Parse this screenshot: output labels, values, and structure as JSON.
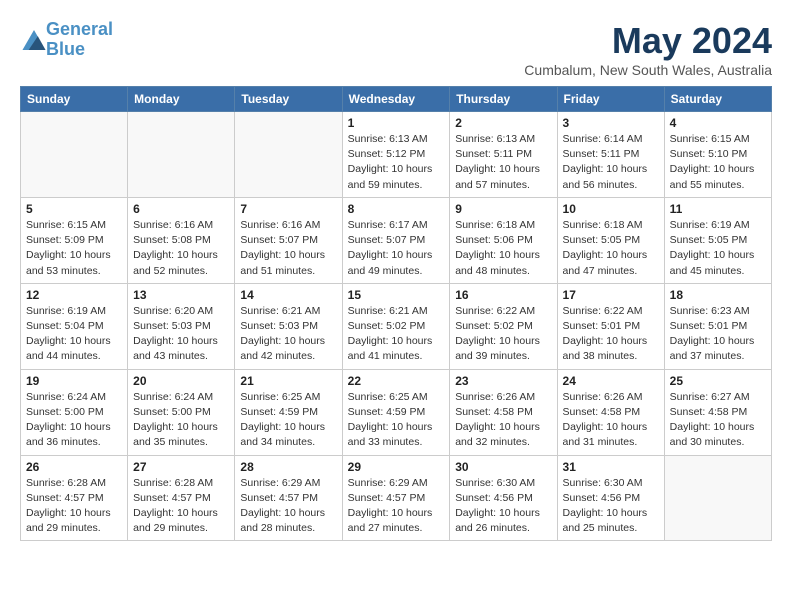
{
  "header": {
    "logo_line1": "General",
    "logo_line2": "Blue",
    "month": "May 2024",
    "location": "Cumbalum, New South Wales, Australia"
  },
  "days_of_week": [
    "Sunday",
    "Monday",
    "Tuesday",
    "Wednesday",
    "Thursday",
    "Friday",
    "Saturday"
  ],
  "weeks": [
    [
      {
        "day": "",
        "info": ""
      },
      {
        "day": "",
        "info": ""
      },
      {
        "day": "",
        "info": ""
      },
      {
        "day": "1",
        "info": "Sunrise: 6:13 AM\nSunset: 5:12 PM\nDaylight: 10 hours\nand 59 minutes."
      },
      {
        "day": "2",
        "info": "Sunrise: 6:13 AM\nSunset: 5:11 PM\nDaylight: 10 hours\nand 57 minutes."
      },
      {
        "day": "3",
        "info": "Sunrise: 6:14 AM\nSunset: 5:11 PM\nDaylight: 10 hours\nand 56 minutes."
      },
      {
        "day": "4",
        "info": "Sunrise: 6:15 AM\nSunset: 5:10 PM\nDaylight: 10 hours\nand 55 minutes."
      }
    ],
    [
      {
        "day": "5",
        "info": "Sunrise: 6:15 AM\nSunset: 5:09 PM\nDaylight: 10 hours\nand 53 minutes."
      },
      {
        "day": "6",
        "info": "Sunrise: 6:16 AM\nSunset: 5:08 PM\nDaylight: 10 hours\nand 52 minutes."
      },
      {
        "day": "7",
        "info": "Sunrise: 6:16 AM\nSunset: 5:07 PM\nDaylight: 10 hours\nand 51 minutes."
      },
      {
        "day": "8",
        "info": "Sunrise: 6:17 AM\nSunset: 5:07 PM\nDaylight: 10 hours\nand 49 minutes."
      },
      {
        "day": "9",
        "info": "Sunrise: 6:18 AM\nSunset: 5:06 PM\nDaylight: 10 hours\nand 48 minutes."
      },
      {
        "day": "10",
        "info": "Sunrise: 6:18 AM\nSunset: 5:05 PM\nDaylight: 10 hours\nand 47 minutes."
      },
      {
        "day": "11",
        "info": "Sunrise: 6:19 AM\nSunset: 5:05 PM\nDaylight: 10 hours\nand 45 minutes."
      }
    ],
    [
      {
        "day": "12",
        "info": "Sunrise: 6:19 AM\nSunset: 5:04 PM\nDaylight: 10 hours\nand 44 minutes."
      },
      {
        "day": "13",
        "info": "Sunrise: 6:20 AM\nSunset: 5:03 PM\nDaylight: 10 hours\nand 43 minutes."
      },
      {
        "day": "14",
        "info": "Sunrise: 6:21 AM\nSunset: 5:03 PM\nDaylight: 10 hours\nand 42 minutes."
      },
      {
        "day": "15",
        "info": "Sunrise: 6:21 AM\nSunset: 5:02 PM\nDaylight: 10 hours\nand 41 minutes."
      },
      {
        "day": "16",
        "info": "Sunrise: 6:22 AM\nSunset: 5:02 PM\nDaylight: 10 hours\nand 39 minutes."
      },
      {
        "day": "17",
        "info": "Sunrise: 6:22 AM\nSunset: 5:01 PM\nDaylight: 10 hours\nand 38 minutes."
      },
      {
        "day": "18",
        "info": "Sunrise: 6:23 AM\nSunset: 5:01 PM\nDaylight: 10 hours\nand 37 minutes."
      }
    ],
    [
      {
        "day": "19",
        "info": "Sunrise: 6:24 AM\nSunset: 5:00 PM\nDaylight: 10 hours\nand 36 minutes."
      },
      {
        "day": "20",
        "info": "Sunrise: 6:24 AM\nSunset: 5:00 PM\nDaylight: 10 hours\nand 35 minutes."
      },
      {
        "day": "21",
        "info": "Sunrise: 6:25 AM\nSunset: 4:59 PM\nDaylight: 10 hours\nand 34 minutes."
      },
      {
        "day": "22",
        "info": "Sunrise: 6:25 AM\nSunset: 4:59 PM\nDaylight: 10 hours\nand 33 minutes."
      },
      {
        "day": "23",
        "info": "Sunrise: 6:26 AM\nSunset: 4:58 PM\nDaylight: 10 hours\nand 32 minutes."
      },
      {
        "day": "24",
        "info": "Sunrise: 6:26 AM\nSunset: 4:58 PM\nDaylight: 10 hours\nand 31 minutes."
      },
      {
        "day": "25",
        "info": "Sunrise: 6:27 AM\nSunset: 4:58 PM\nDaylight: 10 hours\nand 30 minutes."
      }
    ],
    [
      {
        "day": "26",
        "info": "Sunrise: 6:28 AM\nSunset: 4:57 PM\nDaylight: 10 hours\nand 29 minutes."
      },
      {
        "day": "27",
        "info": "Sunrise: 6:28 AM\nSunset: 4:57 PM\nDaylight: 10 hours\nand 29 minutes."
      },
      {
        "day": "28",
        "info": "Sunrise: 6:29 AM\nSunset: 4:57 PM\nDaylight: 10 hours\nand 28 minutes."
      },
      {
        "day": "29",
        "info": "Sunrise: 6:29 AM\nSunset: 4:57 PM\nDaylight: 10 hours\nand 27 minutes."
      },
      {
        "day": "30",
        "info": "Sunrise: 6:30 AM\nSunset: 4:56 PM\nDaylight: 10 hours\nand 26 minutes."
      },
      {
        "day": "31",
        "info": "Sunrise: 6:30 AM\nSunset: 4:56 PM\nDaylight: 10 hours\nand 25 minutes."
      },
      {
        "day": "",
        "info": ""
      }
    ]
  ]
}
